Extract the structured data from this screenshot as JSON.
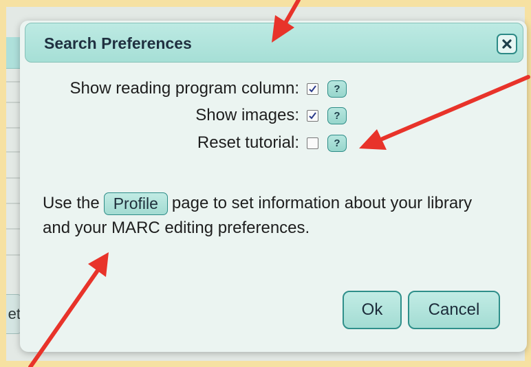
{
  "dialog": {
    "title": "Search Preferences",
    "close_icon": "close-icon"
  },
  "preferences": [
    {
      "label": "Show reading program column:",
      "checked": true,
      "help": "?"
    },
    {
      "label": "Show images:",
      "checked": true,
      "help": "?"
    },
    {
      "label": "Reset tutorial:",
      "checked": false,
      "help": "?"
    }
  ],
  "info": {
    "before": "Use the",
    "profile_button": "Profile",
    "after": "page to set information about your library and your MARC editing preferences."
  },
  "buttons": {
    "ok": "Ok",
    "cancel": "Cancel"
  },
  "background": {
    "partial_button_text": "et"
  },
  "colors": {
    "accent": "#a6dfd6",
    "arrow": "#e8332a",
    "page_border": "#fbe6ad"
  }
}
